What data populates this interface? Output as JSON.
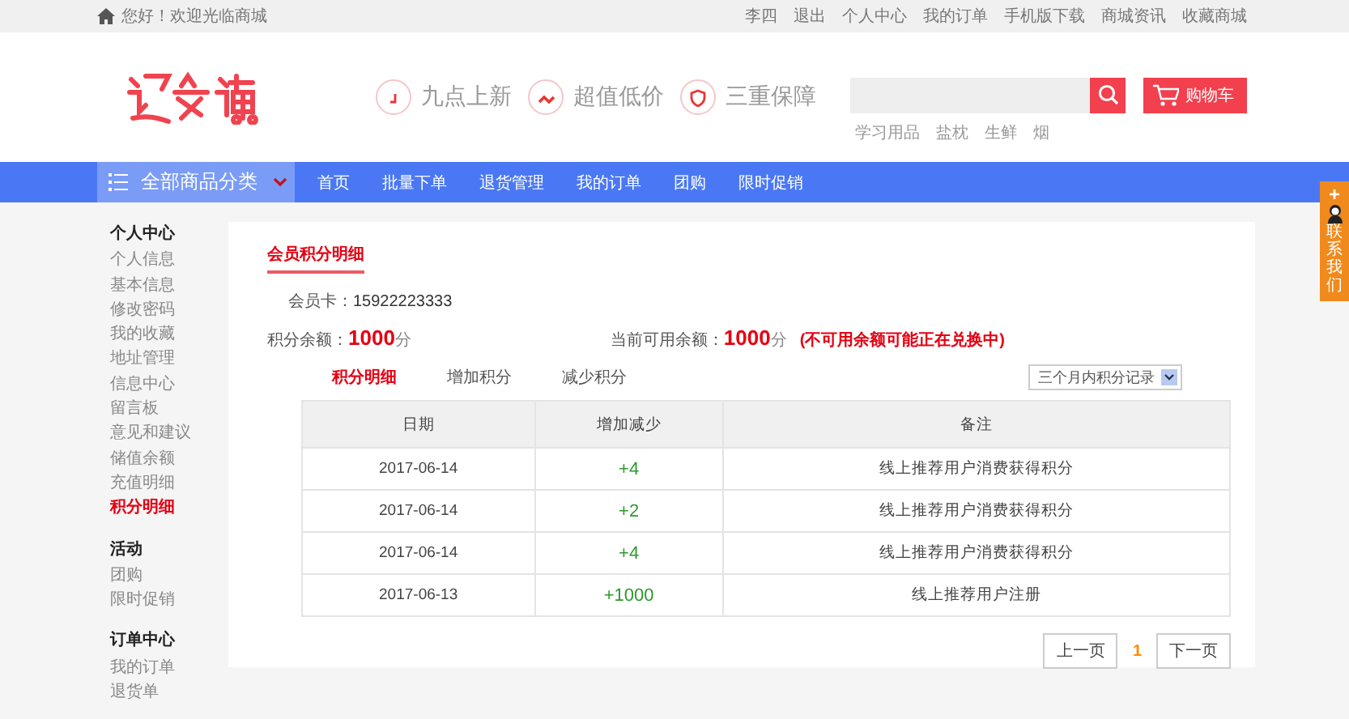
{
  "top_bar": {
    "greeting": "您好！欢迎光临商城",
    "links": [
      "李四",
      "退出",
      "个人中心",
      "我的订单",
      "手机版下载",
      "商城资讯",
      "收藏商城"
    ]
  },
  "header": {
    "features": [
      "九点上新",
      "超值低价",
      "三重保障"
    ],
    "cart_button": "购物车",
    "hot_words": [
      "学习用品",
      "盐枕",
      "生鲜",
      "烟"
    ]
  },
  "nav": {
    "category_button": "全部商品分类",
    "items": [
      "首页",
      "批量下单",
      "退货管理",
      "我的订单",
      "团购",
      "限时促销"
    ]
  },
  "sidebar": {
    "groups": [
      {
        "title": "个人中心",
        "items": [
          {
            "label": "个人信息",
            "selected": false
          },
          {
            "label": "基本信息",
            "selected": false
          },
          {
            "label": "修改密码",
            "selected": false
          },
          {
            "label": "我的收藏",
            "selected": false
          },
          {
            "label": "地址管理",
            "selected": false
          },
          {
            "label": "信息中心",
            "selected": false
          },
          {
            "label": "留言板",
            "selected": false
          },
          {
            "label": "意见和建议",
            "selected": false
          },
          {
            "label": "储值余额",
            "selected": false
          },
          {
            "label": "充值明细",
            "selected": false
          },
          {
            "label": "积分明细",
            "selected": true
          }
        ]
      },
      {
        "title": "活动",
        "items": [
          {
            "label": "团购",
            "selected": false
          },
          {
            "label": "限时促销",
            "selected": false
          }
        ]
      },
      {
        "title": "订单中心",
        "items": [
          {
            "label": "我的订单",
            "selected": false
          },
          {
            "label": "退货单",
            "selected": false
          }
        ]
      }
    ]
  },
  "panel": {
    "title": "会员积分明细",
    "card_label": "会员卡：",
    "card_number": "15922223333",
    "balance_label": "积分余额：",
    "balance_value": "1000",
    "balance_unit": "分",
    "available_label": "当前可用余额：",
    "available_value": "1000",
    "available_unit": "分",
    "note": "(不可用余额可能正在兑换中)",
    "tabs": [
      {
        "label": "积分明细",
        "selected": true
      },
      {
        "label": "增加积分",
        "selected": false
      },
      {
        "label": "减少积分",
        "selected": false
      }
    ],
    "filter": "三个月内积分记录",
    "table": {
      "columns": [
        "日期",
        "增加减少",
        "备注"
      ],
      "rows": [
        [
          "2017-06-14",
          "+4",
          "线上推荐用户消费获得积分"
        ],
        [
          "2017-06-14",
          "+2",
          "线上推荐用户消费获得积分"
        ],
        [
          "2017-06-14",
          "+4",
          "线上推荐用户消费获得积分"
        ],
        [
          "2017-06-13",
          "+1000",
          "线上推荐用户注册"
        ]
      ]
    },
    "pagination": {
      "prev": "上一页",
      "pages": [
        {
          "label": "1",
          "selected": true
        }
      ],
      "next": "下一页"
    }
  },
  "contact_tab": {
    "plus": "+",
    "label": "联系我们"
  }
}
